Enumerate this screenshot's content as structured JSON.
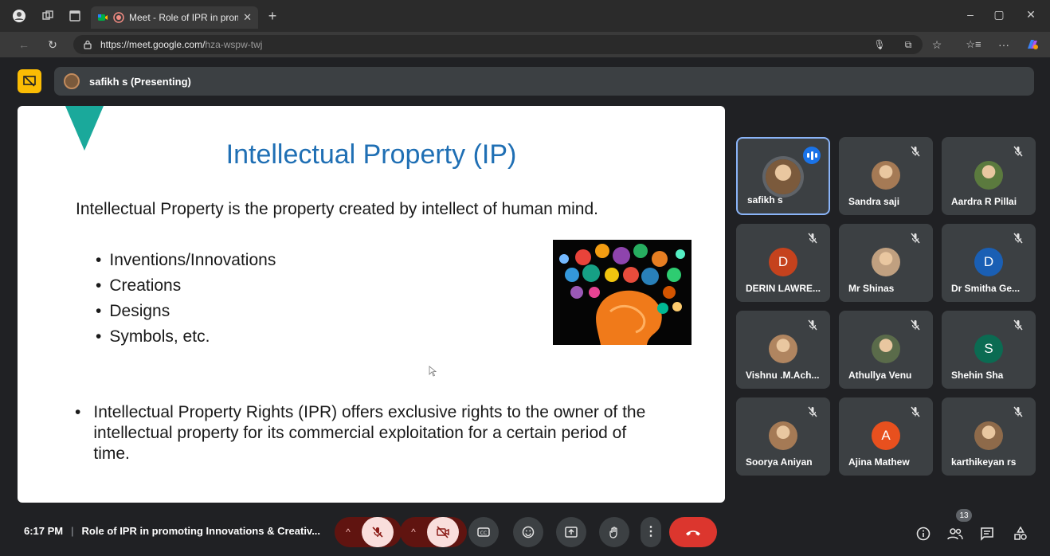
{
  "browser": {
    "tab_title": "Meet - Role of IPR in promot",
    "url_host": "https://meet.google.com/",
    "url_path": "hza-wspw-twj"
  },
  "presenting": {
    "label": "safikh s (Presenting)"
  },
  "slide": {
    "title": "Intellectual Property (IP)",
    "subtitle": "Intellectual Property is the property created by intellect of human mind.",
    "bullets": [
      "Inventions/Innovations",
      "Creations",
      "Designs",
      "Symbols, etc."
    ],
    "ipr_text": "Intellectual Property Rights (IPR) offers exclusive rights to the owner of the intellectual property for its commercial exploitation for a certain period of time."
  },
  "participants": [
    {
      "name": "safikh s",
      "avatar": "photo",
      "speaking": true,
      "muted": false
    },
    {
      "name": "Sandra saji",
      "avatar": "photo",
      "muted": true
    },
    {
      "name": "Aardra R Pillai",
      "avatar": "photo",
      "muted": true
    },
    {
      "name": "DERIN LAWRE...",
      "avatar": "D",
      "color": "#c5421d",
      "muted": true
    },
    {
      "name": "Mr Shinas",
      "avatar": "photo",
      "muted": true
    },
    {
      "name": "Dr Smitha Ge...",
      "avatar": "D",
      "color": "#1a5fb4",
      "muted": true
    },
    {
      "name": "Vishnu .M.Ach...",
      "avatar": "photo",
      "muted": true
    },
    {
      "name": "Athullya Venu",
      "avatar": "photo",
      "muted": true
    },
    {
      "name": "Shehin Sha",
      "avatar": "S",
      "color": "#0b6b52",
      "muted": true
    },
    {
      "name": "Soorya Aniyan",
      "avatar": "photo",
      "muted": true
    },
    {
      "name": "Ajina Mathew",
      "avatar": "A",
      "color": "#e8501e",
      "muted": true
    },
    {
      "name": "karthikeyan rs",
      "avatar": "photo",
      "muted": true
    }
  ],
  "bottom": {
    "time": "6:17 PM",
    "meeting_title": "Role of IPR in promoting Innovations & Creativ...",
    "people_count": "13"
  }
}
